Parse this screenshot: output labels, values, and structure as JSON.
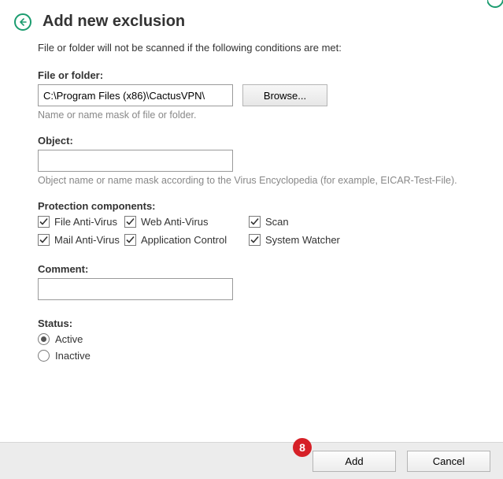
{
  "header": {
    "title": "Add new exclusion"
  },
  "intro": "File or folder will not be scanned if the following conditions are met:",
  "file": {
    "label": "File or folder:",
    "value": "C:\\Program Files (x86)\\CactusVPN\\",
    "browse": "Browse...",
    "hint": "Name or name mask of file or folder."
  },
  "object": {
    "label": "Object:",
    "value": "",
    "hint": "Object name or name mask according to the Virus Encyclopedia (for example, EICAR-Test-File)."
  },
  "components": {
    "label": "Protection components:",
    "row1": {
      "a": "File Anti-Virus",
      "b": "Web Anti-Virus",
      "c": "Scan"
    },
    "row2": {
      "a": "Mail Anti-Virus",
      "b": "Application Control",
      "c": "System Watcher"
    }
  },
  "comment": {
    "label": "Comment:",
    "value": ""
  },
  "status": {
    "label": "Status:",
    "active": "Active",
    "inactive": "Inactive"
  },
  "footer": {
    "add": "Add",
    "cancel": "Cancel"
  },
  "badge": "8"
}
